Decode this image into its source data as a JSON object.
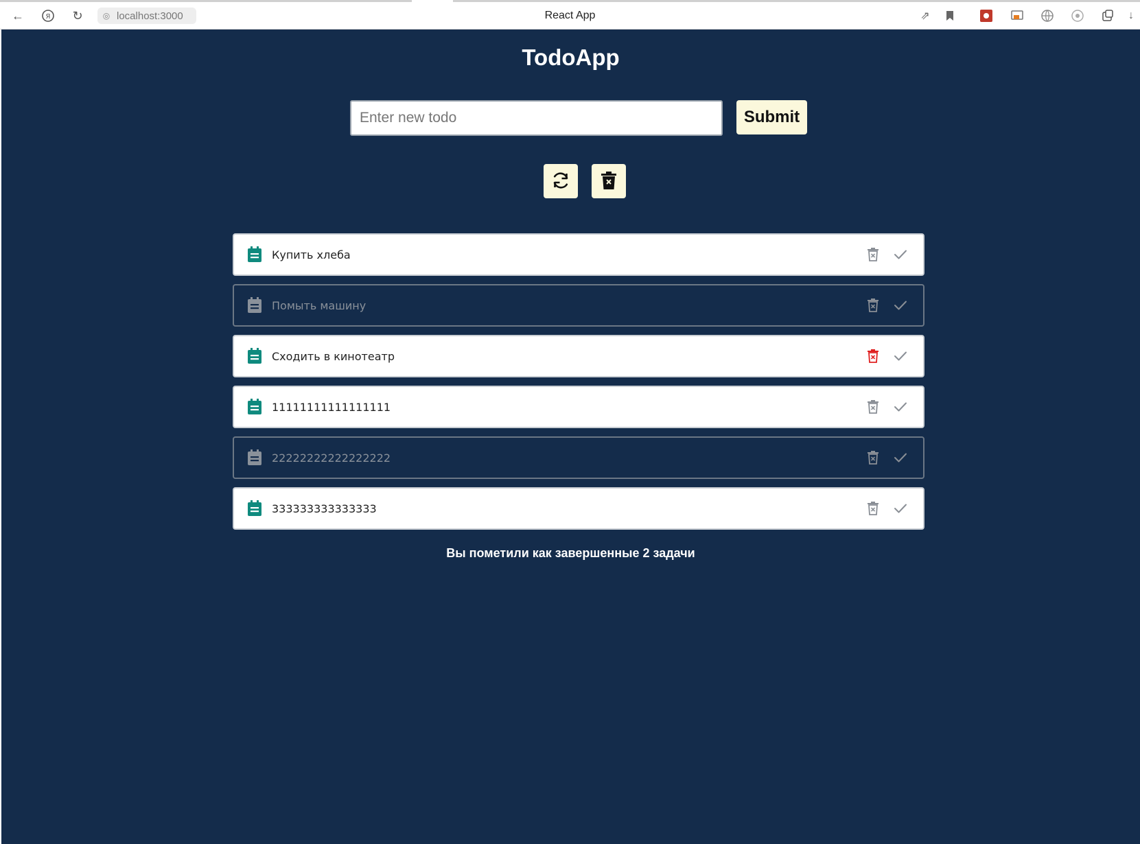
{
  "browser": {
    "url": "localhost:3000",
    "tab_title": "React App"
  },
  "app": {
    "title": "TodoApp",
    "input": {
      "placeholder": "Enter new todo",
      "value": ""
    },
    "submit_label": "Submit",
    "summary": "Вы пометили как завершенные 2 задачи"
  },
  "todos": [
    {
      "text": "Купить хлеба",
      "done": false
    },
    {
      "text": "Помыть машину",
      "done": true
    },
    {
      "text": "Сходить в кинотеатр",
      "done": false,
      "delete_hovered": true
    },
    {
      "text": "11111111111111111",
      "done": false
    },
    {
      "text": "22222222222222222",
      "done": true
    },
    {
      "text": "333333333333333",
      "done": false
    }
  ],
  "colors": {
    "background": "#142c4b",
    "button_bg": "#fbf8dc",
    "note_icon_active": "#0f8a7e",
    "note_icon_done": "#8a919a",
    "delete_hover": "#e02020"
  }
}
